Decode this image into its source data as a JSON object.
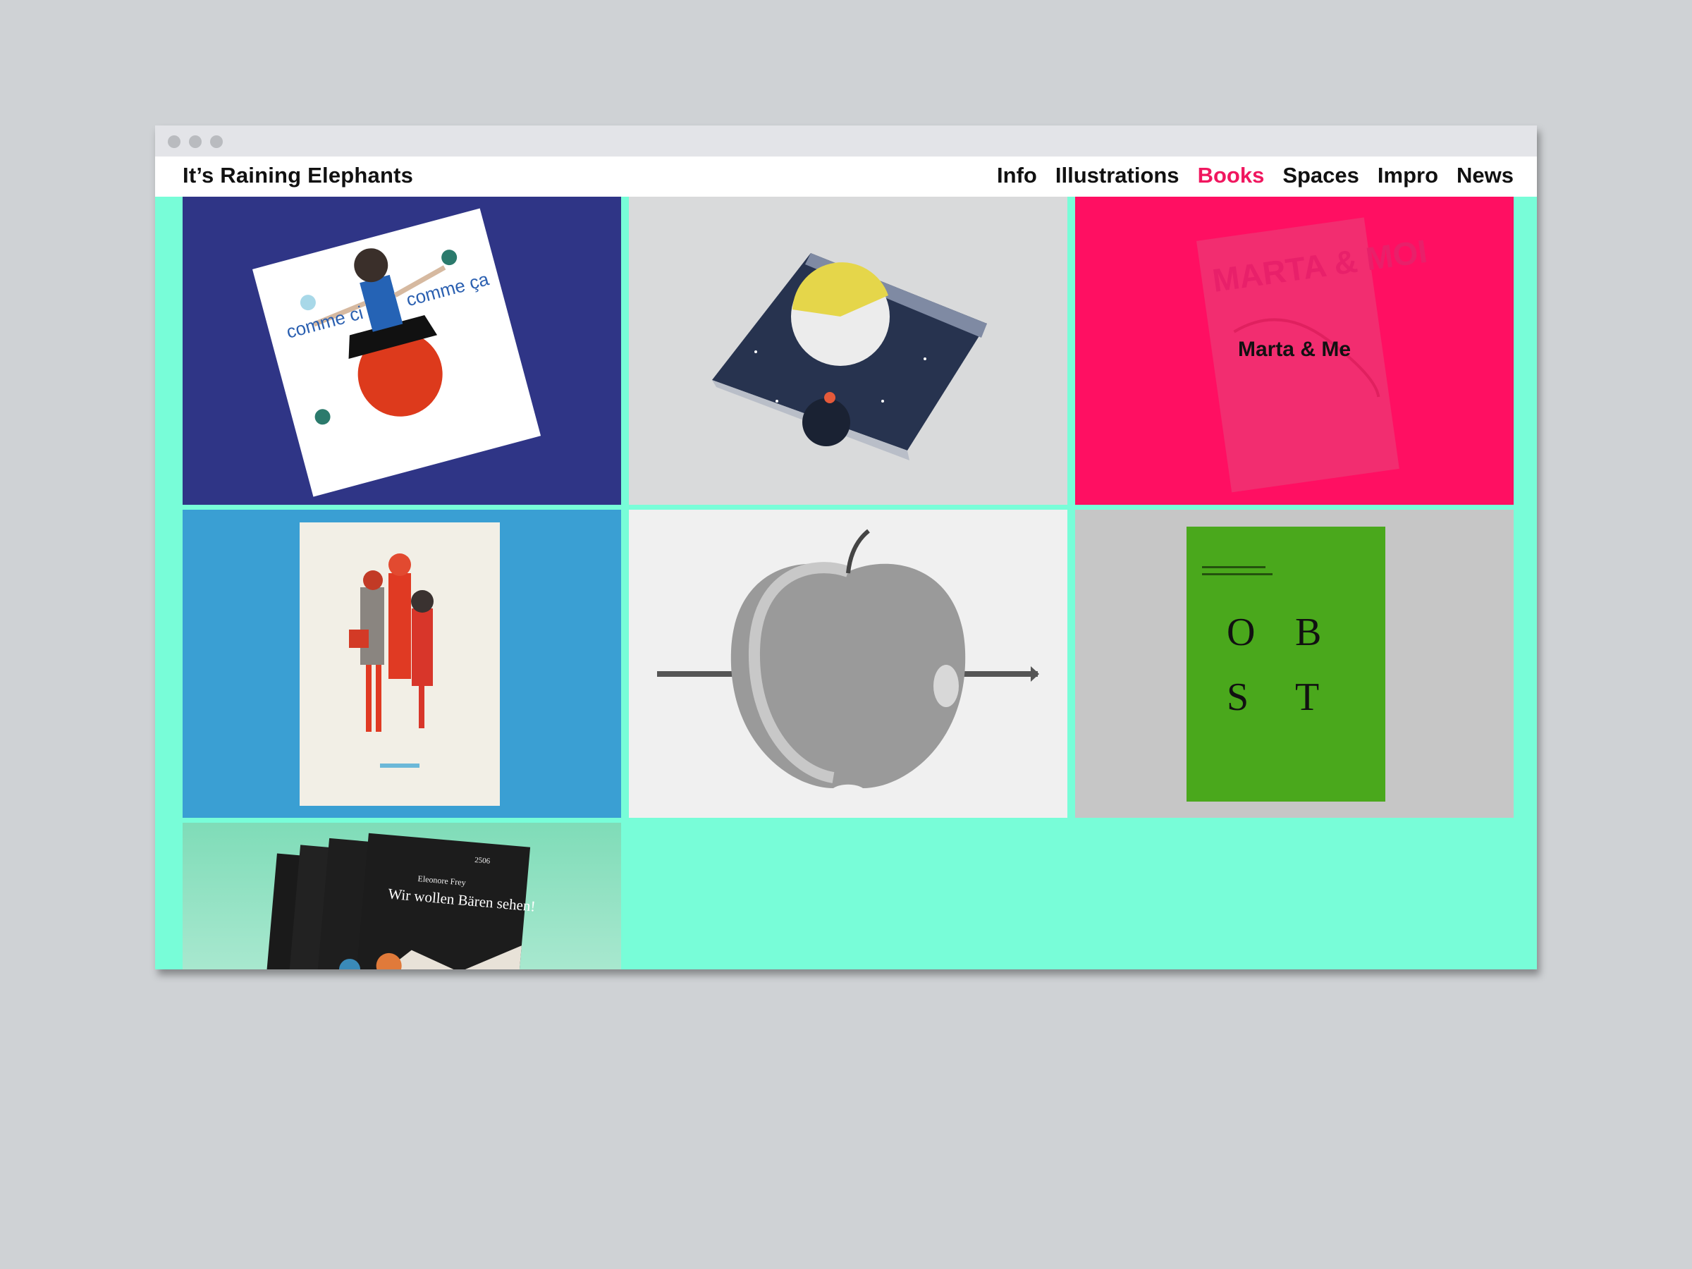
{
  "site": {
    "title": "It’s Raining Elephants"
  },
  "nav": {
    "items": [
      {
        "label": "Info",
        "active": false
      },
      {
        "label": "Illustrations",
        "active": false
      },
      {
        "label": "Books",
        "active": true
      },
      {
        "label": "Spaces",
        "active": false
      },
      {
        "label": "Impro",
        "active": false
      },
      {
        "label": "News",
        "active": false
      }
    ]
  },
  "colors": {
    "background": "#78fdd8",
    "accent": "#f0175f",
    "text": "#111111"
  },
  "books": [
    {
      "cover_left": "comme ci",
      "cover_right": "comme ça"
    },
    {},
    {
      "hover_label": "Marta & Me",
      "cover_title": "MARTA & MOI"
    },
    {},
    {},
    {
      "cover_letters": [
        "O",
        "B",
        "S",
        "T"
      ]
    },
    {
      "cover_number": "2506",
      "cover_author": "Eleonore Frey",
      "cover_title": "Wir wollen Bären sehen!"
    }
  ]
}
